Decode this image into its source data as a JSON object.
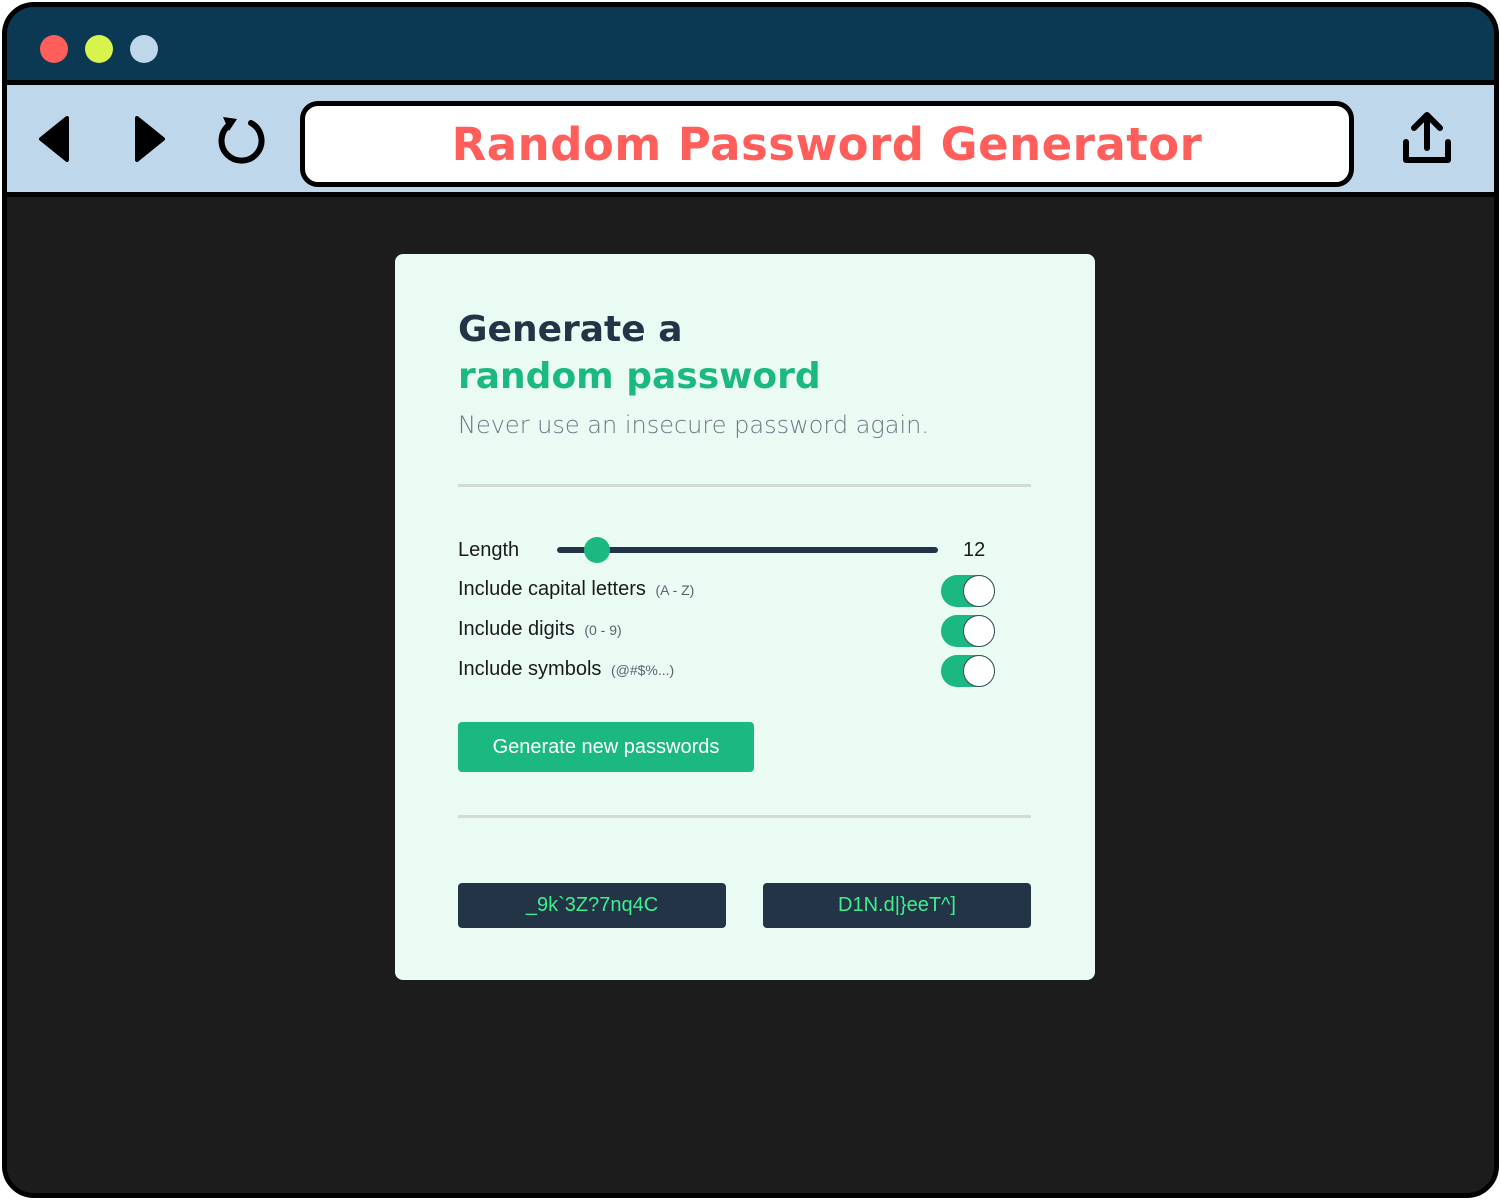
{
  "window": {
    "colors": {
      "close": "#ff5e5b",
      "minimize": "#d8f34b",
      "maximize": "#bfd7ea"
    }
  },
  "toolbar": {
    "address_text": "Random Password Generator",
    "icons": [
      "back-arrow-icon",
      "forward-arrow-icon",
      "reload-icon",
      "share-icon"
    ]
  },
  "card": {
    "heading_line1": "Generate a",
    "heading_line2": "random password",
    "subtitle": "Never use an insecure password again.",
    "length": {
      "label": "Length",
      "value": "12"
    },
    "options": [
      {
        "label": "Include capital letters",
        "hint": "(A - Z)",
        "enabled": true
      },
      {
        "label": "Include digits",
        "hint": "(0 - 9)",
        "enabled": true
      },
      {
        "label": "Include symbols",
        "hint": "(@#$%...)",
        "enabled": true
      }
    ],
    "generate_button": "Generate new passwords",
    "passwords": [
      "_9k`3Z?7nq4C",
      "D1N.d|}eeT^]"
    ],
    "accent_color": "#1cb882",
    "password_text_color": "#3ef08d"
  }
}
